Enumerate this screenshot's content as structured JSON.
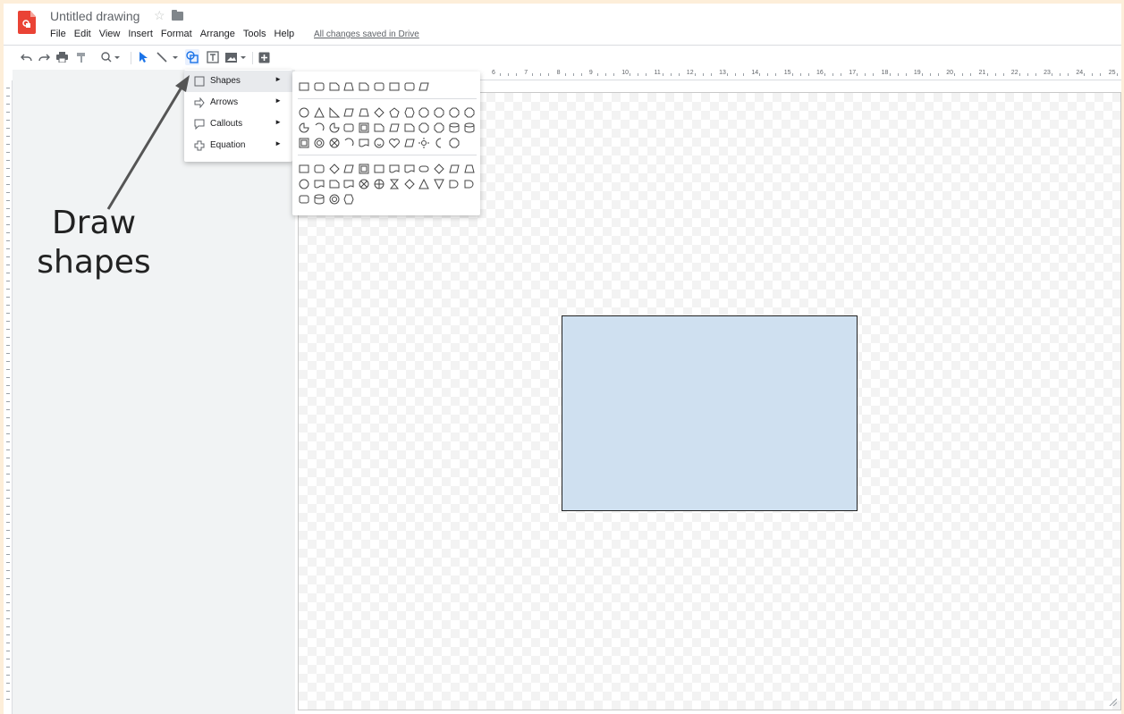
{
  "header": {
    "doc_title": "Untitled drawing",
    "menu": [
      "File",
      "Edit",
      "View",
      "Insert",
      "Format",
      "Arrange",
      "Tools",
      "Help"
    ],
    "save_status": "All changes saved in Drive"
  },
  "toolbar": {
    "icons": [
      "undo-icon",
      "redo-icon",
      "print-icon",
      "paint-format-icon",
      "zoom-icon",
      "select-icon",
      "line-icon",
      "shape-icon",
      "text-box-icon",
      "image-icon",
      "insert-plus-icon"
    ]
  },
  "ruler": {
    "top_labels": [
      "6",
      "7",
      "8",
      "9",
      "10",
      "11",
      "12",
      "13",
      "14",
      "15",
      "16",
      "17",
      "18",
      "19",
      "20",
      "21",
      "22",
      "23",
      "24",
      "25"
    ]
  },
  "insert_menu": {
    "items": [
      {
        "label": "Shapes",
        "icon": "square-icon",
        "highlighted": true
      },
      {
        "label": "Arrows",
        "icon": "arrow-icon",
        "highlighted": false
      },
      {
        "label": "Callouts",
        "icon": "callout-icon",
        "highlighted": false
      },
      {
        "label": "Equation",
        "icon": "equation-icon",
        "highlighted": false
      }
    ]
  },
  "annotation": {
    "line1": "Draw",
    "line2": "shapes"
  },
  "colors": {
    "accent": "#1a73e8",
    "logo": "#ea4335",
    "rect_fill": "#cfe0f0",
    "frame": "#fdeed9"
  }
}
